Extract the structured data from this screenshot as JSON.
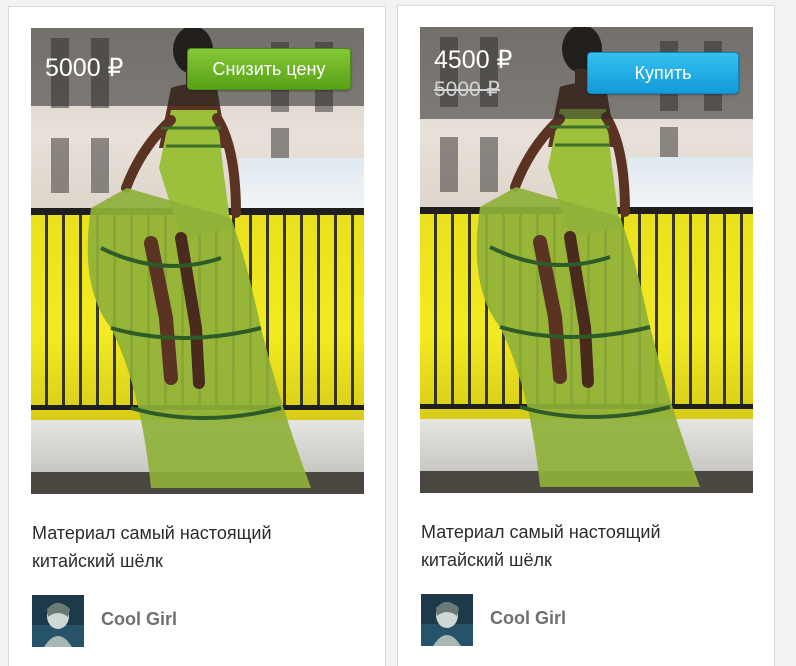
{
  "cards": [
    {
      "price": "5000 ₽",
      "action_label": "Снизить цену",
      "description_line1": "Материал самый настоящий",
      "description_line2": "китайский шёлк",
      "author": "Cool Girl"
    },
    {
      "price": "4500 ₽",
      "old_price": "5000 ₽",
      "action_label": "Купить",
      "description_line1": "Материал самый настоящий",
      "description_line2": "китайский шёлк",
      "author": "Cool Girl"
    }
  ],
  "colors": {
    "green_button": "#66ad1f",
    "blue_button": "#1ba9e4",
    "author_text": "#6f6f6f",
    "description_text": "#2b2b2b"
  },
  "icons": {
    "avatar": "user-photo",
    "product_photo": "woman-green-dress-photo"
  }
}
